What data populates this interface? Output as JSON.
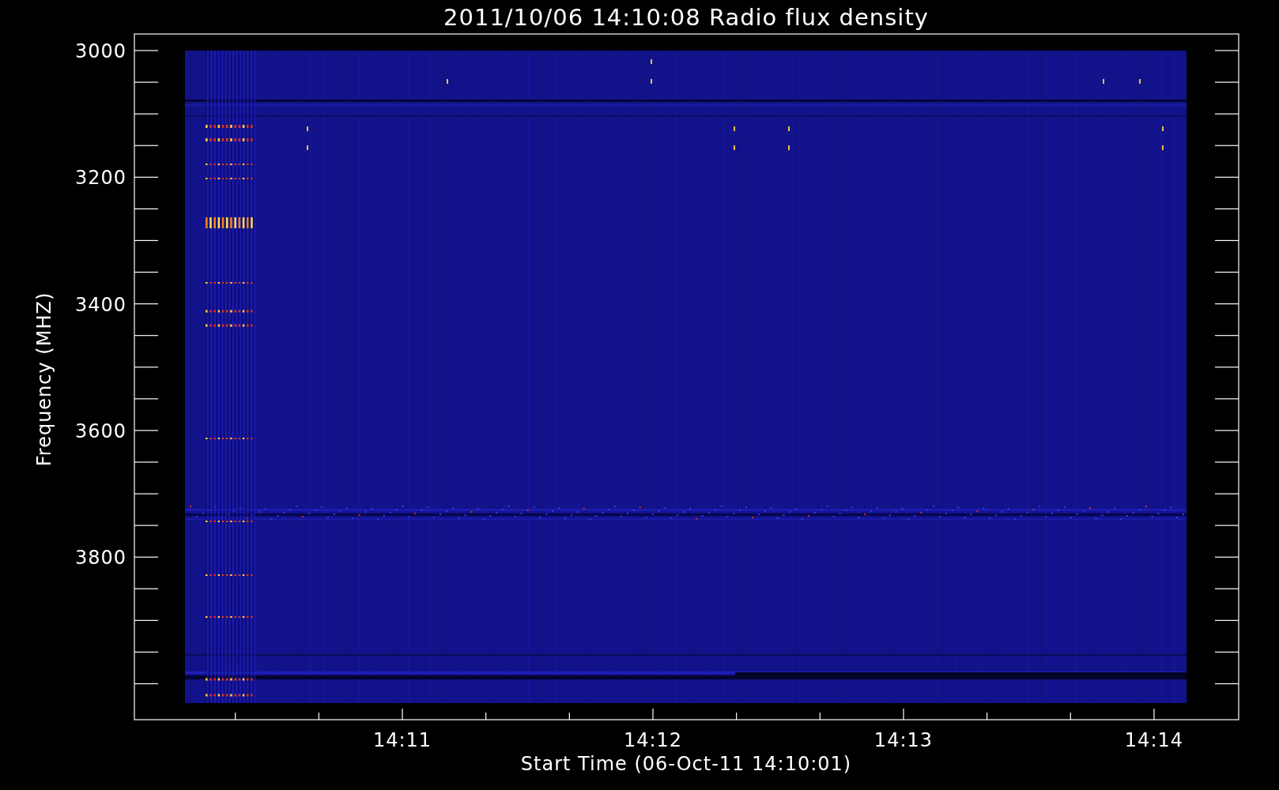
{
  "title": "2011/10/06 14:10:08 Radio flux density",
  "y_axis": {
    "label": "Frequency (MHZ)",
    "ticks": [
      "3000",
      "3200",
      "3400",
      "3600",
      "3800"
    ]
  },
  "x_axis": {
    "label": "Start Time (06-Oct-11 14:10:01)",
    "ticks": [
      "14:11",
      "14:12",
      "14:13",
      "14:14"
    ]
  }
}
